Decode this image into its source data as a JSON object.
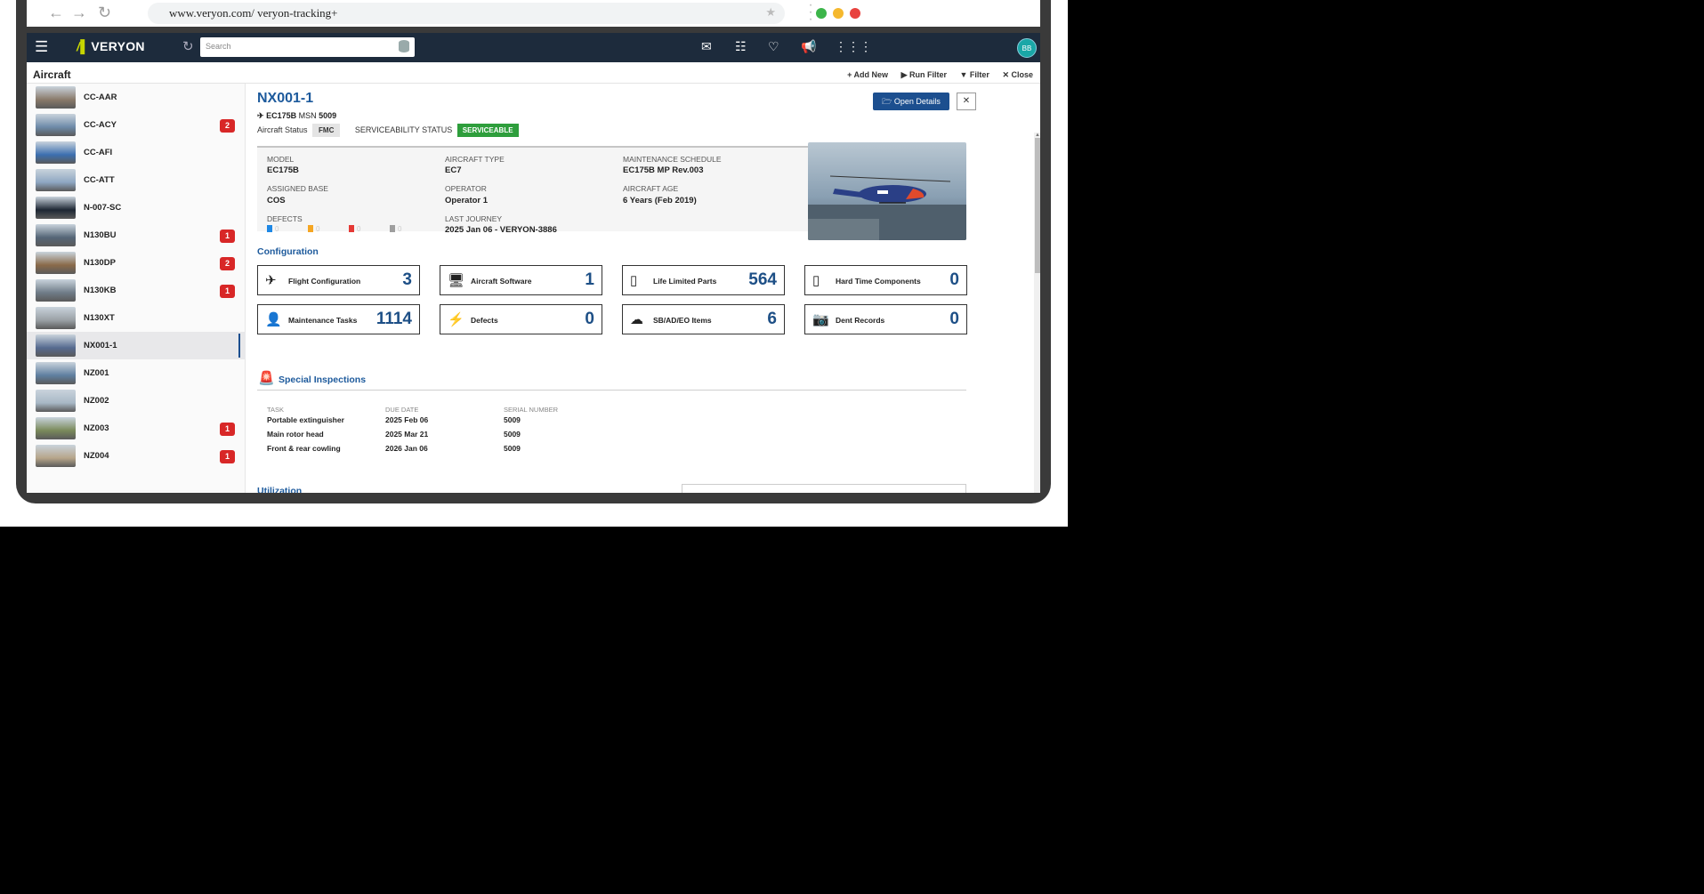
{
  "browser": {
    "url": "www.veryon.com/  veryon-tracking+",
    "back_icon": "arrow-left-icon",
    "forward_icon": "arrow-right-icon",
    "reload_icon": "reload-icon"
  },
  "app": {
    "brand": "VERYON",
    "search_placeholder": "Search",
    "avatar_initials": "BB"
  },
  "page": {
    "title": "Aircraft",
    "actions": {
      "add_new": "+ Add New",
      "run_filter": "▶ Run Filter",
      "filter": "▼ Filter",
      "close": "✕ Close"
    }
  },
  "aircraft_list": [
    {
      "tail": "CC-AAR",
      "badge": ""
    },
    {
      "tail": "CC-ACY",
      "badge": "2"
    },
    {
      "tail": "CC-AFI",
      "badge": ""
    },
    {
      "tail": "CC-ATT",
      "badge": ""
    },
    {
      "tail": "N-007-SC",
      "badge": ""
    },
    {
      "tail": "N130BU",
      "badge": "1"
    },
    {
      "tail": "N130DP",
      "badge": "2"
    },
    {
      "tail": "N130KB",
      "badge": "1"
    },
    {
      "tail": "N130XT",
      "badge": ""
    },
    {
      "tail": "NX001-1",
      "badge": "",
      "selected": true
    },
    {
      "tail": "NZ001",
      "badge": ""
    },
    {
      "tail": "NZ002",
      "badge": ""
    },
    {
      "tail": "NZ003",
      "badge": "1"
    },
    {
      "tail": "NZ004",
      "badge": "1"
    }
  ],
  "detail": {
    "title": "NX001-1",
    "model_line_model": "EC175B",
    "model_line_msn_label": "MSN",
    "model_line_msn": "5009",
    "aircraft_status_label": "Aircraft Status",
    "aircraft_status": "FMC",
    "serviceability_label": "SERVICEABILITY STATUS",
    "serviceability": "SERVICEABLE",
    "open_details": "Open Details",
    "close": "✕",
    "fields": {
      "model_label": "MODEL",
      "model": "EC175B",
      "type_label": "AIRCRAFT TYPE",
      "type": "EC7",
      "schedule_label": "MAINTENANCE SCHEDULE",
      "schedule": "EC175B MP Rev.003",
      "base_label": "ASSIGNED BASE",
      "base": "COS",
      "operator_label": "OPERATOR",
      "operator": "Operator 1",
      "age_label": "AIRCRAFT AGE",
      "age": "6 Years (Feb 2019)",
      "defects_label": "DEFECTS",
      "journey_label": "LAST JOURNEY",
      "journey": "2025 Jan 06 - VERYON-3886"
    },
    "defect_counts": [
      {
        "color": "#1e88e5",
        "count": "0"
      },
      {
        "color": "#f5a623",
        "count": "0"
      },
      {
        "color": "#e53935",
        "count": "0"
      },
      {
        "color": "#9e9e9e",
        "count": "0"
      }
    ],
    "configuration_title": "Configuration",
    "cards": [
      {
        "label": "Flight Configuration",
        "value": "3",
        "icon": "airplane-icon",
        "glyph": "✈"
      },
      {
        "label": "Aircraft Software",
        "value": "1",
        "icon": "monitor-icon",
        "glyph": "🖥"
      },
      {
        "label": "Life Limited Parts",
        "value": "564",
        "icon": "phone-icon",
        "glyph": "▯"
      },
      {
        "label": "Hard Time Components",
        "value": "0",
        "icon": "phone-icon",
        "glyph": "▯"
      },
      {
        "label": "Maintenance Tasks",
        "value": "1114",
        "icon": "person-icon",
        "glyph": "👤"
      },
      {
        "label": "Defects",
        "value": "0",
        "icon": "lightning-icon",
        "glyph": "⚡"
      },
      {
        "label": "SB/AD/EO Items",
        "value": "6",
        "icon": "cloud-download-icon",
        "glyph": "☁"
      },
      {
        "label": "Dent Records",
        "value": "0",
        "icon": "camera-icon",
        "glyph": "📷"
      }
    ],
    "special_title": "Special Inspections",
    "special_headers": [
      "TASK",
      "DUE DATE",
      "SERIAL NUMBER"
    ],
    "special_rows": [
      [
        "Portable extinguisher",
        "2025 Feb 06",
        "5009"
      ],
      [
        "Main rotor head",
        "2025 Mar 21",
        "5009"
      ],
      [
        "Front & rear cowling",
        "2026 Jan 06",
        "5009"
      ]
    ],
    "utilization_title": "Utilization"
  },
  "colors": {
    "brand_navy": "#1d2b3c",
    "accent_blue": "#1d5a9c",
    "badge_red": "#d82727",
    "serviceable_green": "#2e9e3c"
  }
}
